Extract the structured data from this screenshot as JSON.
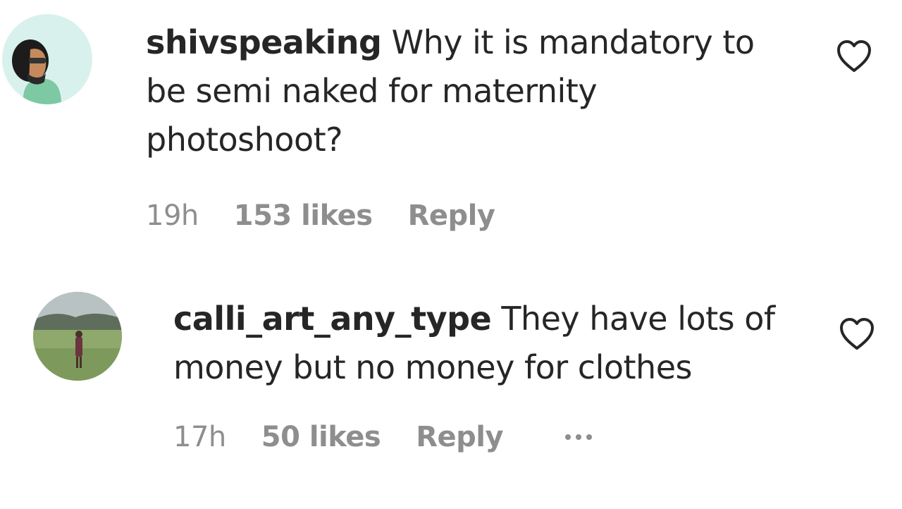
{
  "comments": [
    {
      "username": "shivspeaking",
      "text": "Why it is mandatory to be semi naked for maternity photoshoot?",
      "time": "19h",
      "likes": "153 likes",
      "reply_label": "Reply",
      "avatar_icon": "avatar-person-icon",
      "like_icon": "heart-outline-icon"
    },
    {
      "username": "calli_art_any_type",
      "text": "They have lots of money but no money for clothes",
      "time": "17h",
      "likes": "50 likes",
      "reply_label": "Reply",
      "avatar_icon": "avatar-field-icon",
      "like_icon": "heart-outline-icon",
      "more_icon": "more-options-icon"
    }
  ],
  "colors": {
    "text": "#262626",
    "secondary": "#8e8e8e",
    "background": "#ffffff"
  }
}
